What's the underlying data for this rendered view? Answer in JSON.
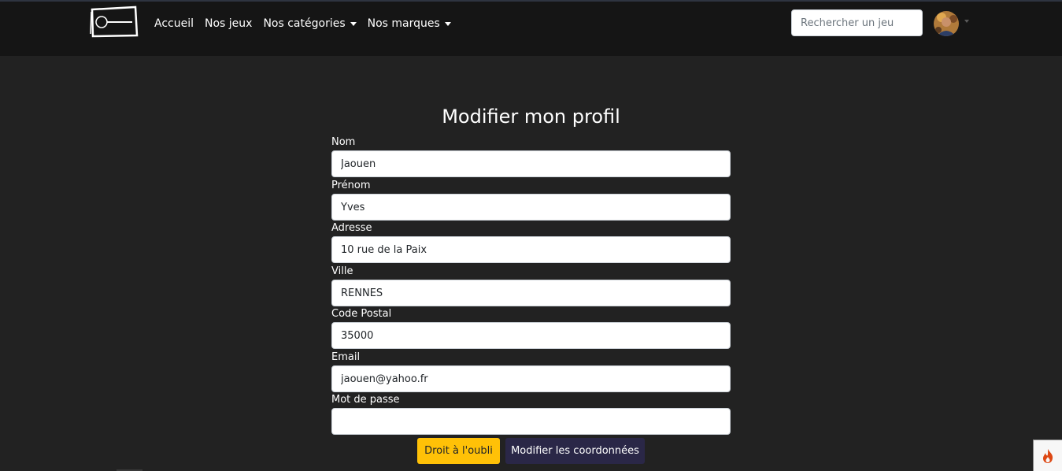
{
  "nav": {
    "links": [
      {
        "label": "Accueil",
        "dropdown": false
      },
      {
        "label": "Nos jeux",
        "dropdown": false
      },
      {
        "label": "Nos catégories",
        "dropdown": true
      },
      {
        "label": "Nos marques",
        "dropdown": true
      }
    ],
    "search_placeholder": "Rechercher un jeu"
  },
  "page": {
    "title": "Modifier mon profil"
  },
  "form": {
    "nom": {
      "label": "Nom",
      "value": "Jaouen"
    },
    "prenom": {
      "label": "Prénom",
      "value": "Yves"
    },
    "adresse": {
      "label": "Adresse",
      "value": "10 rue de la Paix"
    },
    "ville": {
      "label": "Ville",
      "value": "RENNES"
    },
    "code_postal": {
      "label": "Code Postal",
      "value": "35000"
    },
    "email": {
      "label": "Email",
      "value": "jaouen@yahoo.fr"
    },
    "mot_de_passe": {
      "label": "Mot de passe",
      "value": ""
    }
  },
  "buttons": {
    "forget": "Droit à l'oubli",
    "update": "Modifier les coordonnées"
  },
  "colors": {
    "background": "#222222",
    "navbar": "#151515",
    "forget_button": "#ffc107",
    "update_button": "#2a2747"
  }
}
